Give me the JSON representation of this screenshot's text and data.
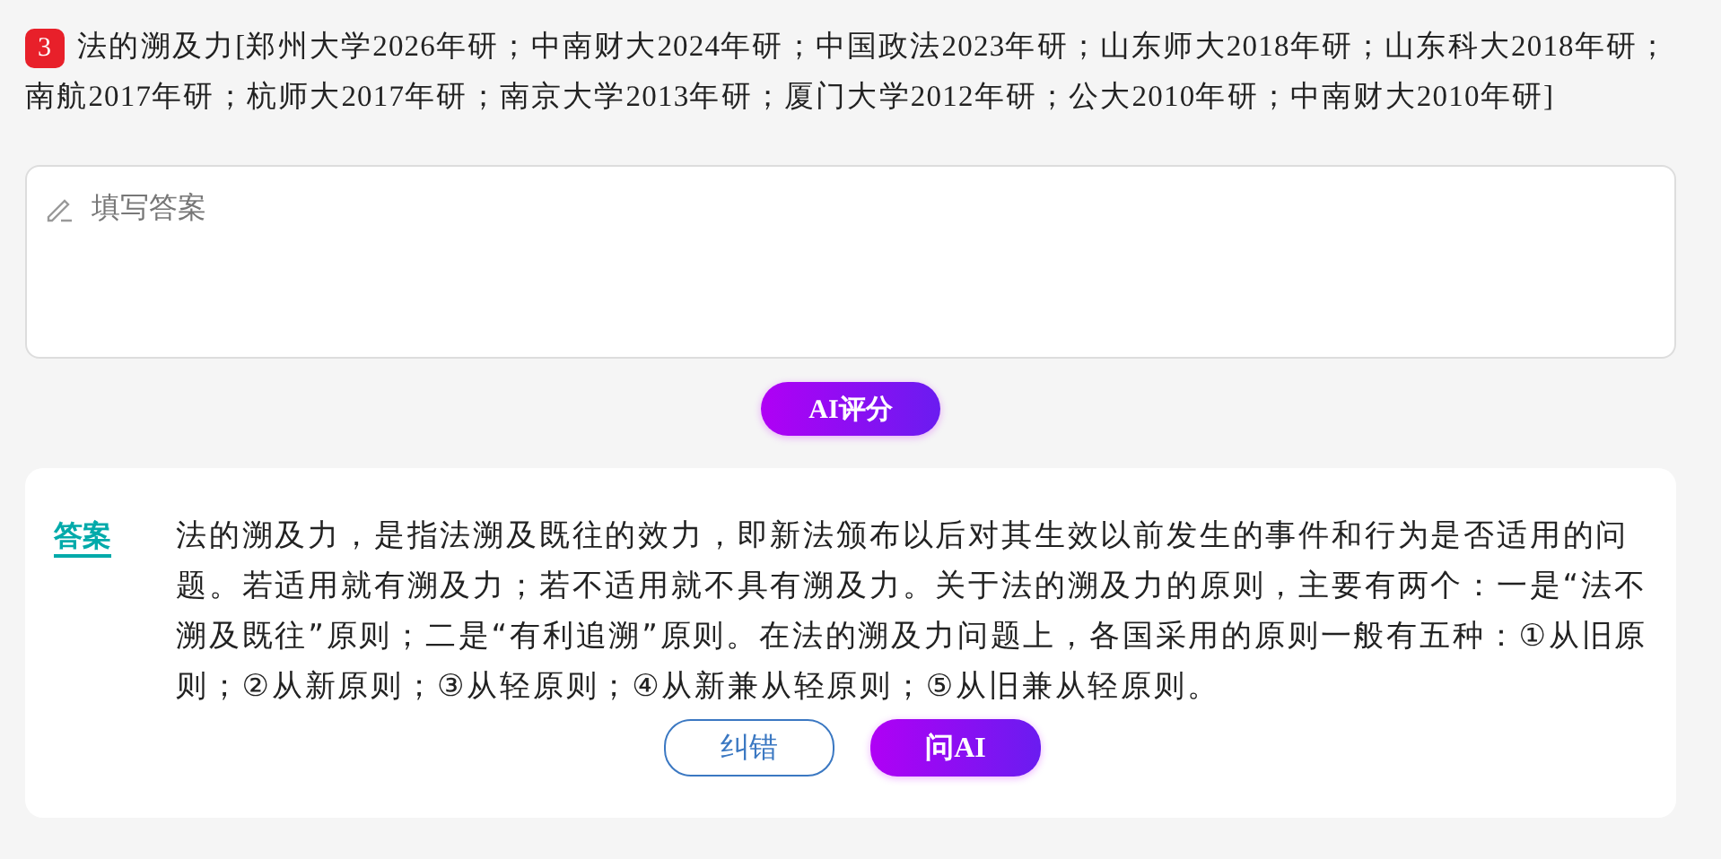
{
  "question": {
    "number": "3",
    "text": "法的溯及力[郑州大学2026年研；中南财大2024年研；中国政法2023年研；山东师大2018年研；山东科大2018年研；南航2017年研；杭师大2017年研；南京大学2013年研；厦门大学2012年研；公大2010年研；中南财大2010年研]"
  },
  "answer_field": {
    "placeholder": "填写答案"
  },
  "grade_button": "AI评分",
  "answer": {
    "label": "答案",
    "text": "法的溯及力，是指法溯及既往的效力，即新法颁布以后对其生效以前发生的事件和行为是否适用的问题。若适用就有溯及力；若不适用就不具有溯及力。关于法的溯及力的原则，主要有两个：一是“法不溯及既往”原则；二是“有利追溯”原则。在法的溯及力问题上，各国采用的原则一般有五种：①从旧原则；②从新原则；③从轻原则；④从新兼从轻原则；⑤从旧兼从轻原则。"
  },
  "buttons": [
    {
      "label": "纠错",
      "kind": "outline"
    },
    {
      "label": "问AI",
      "kind": "primary"
    }
  ]
}
